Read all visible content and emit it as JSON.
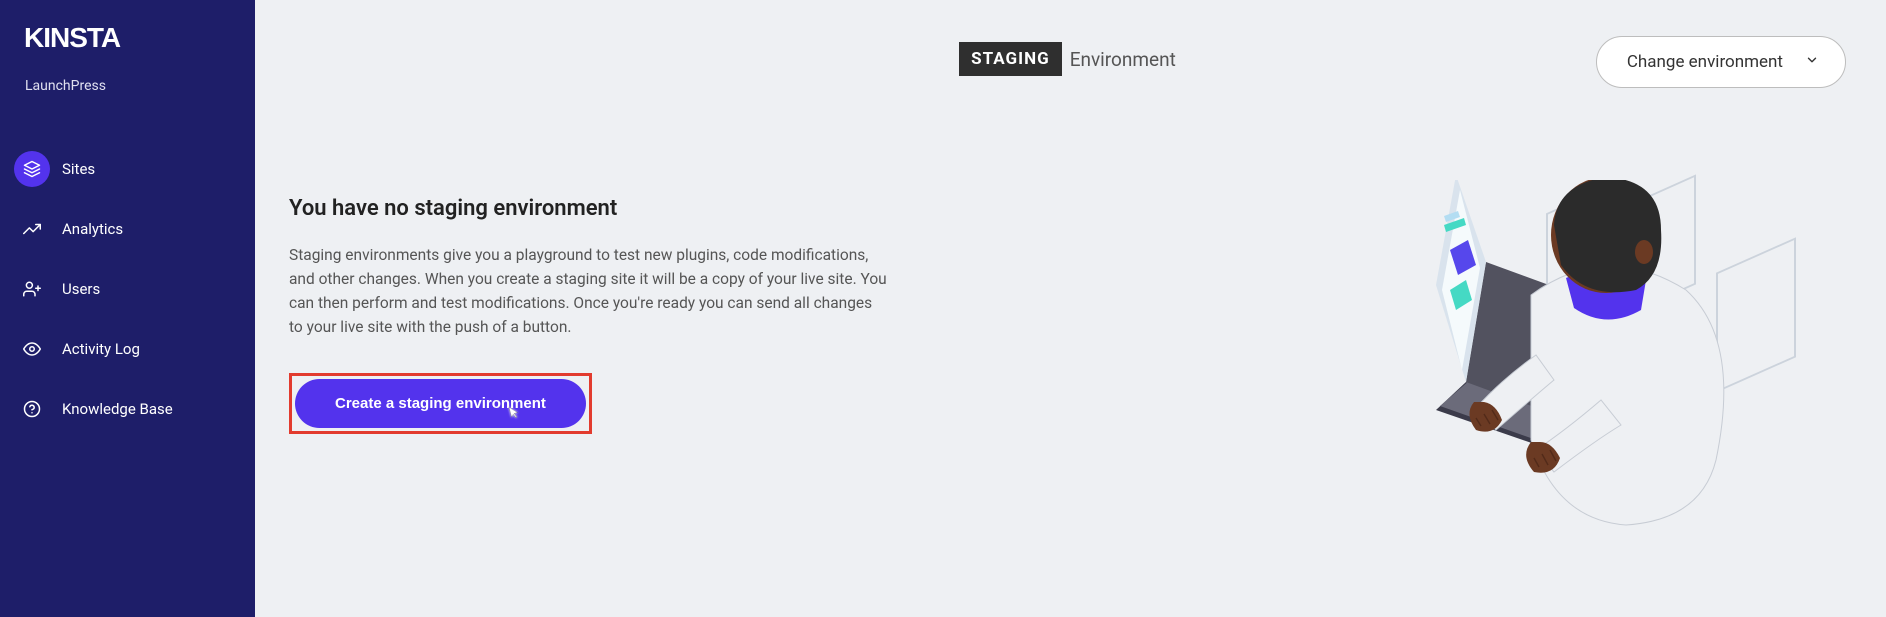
{
  "brand": "KINSTA",
  "site_name": "LaunchPress",
  "sidebar": {
    "items": [
      {
        "label": "Sites",
        "icon": "layers",
        "active": true
      },
      {
        "label": "Analytics",
        "icon": "trending-up",
        "active": false
      },
      {
        "label": "Users",
        "icon": "user-plus",
        "active": false
      },
      {
        "label": "Activity Log",
        "icon": "eye",
        "active": false
      },
      {
        "label": "Knowledge Base",
        "icon": "help-circle",
        "active": false
      }
    ]
  },
  "header": {
    "badge": "STAGING",
    "label": "Environment",
    "dropdown_label": "Change environment"
  },
  "content": {
    "heading": "You have no staging environment",
    "body": "Staging environments give you a playground to test new plugins, code modifications, and other changes. When you create a staging site it will be a copy of your live site. You can then perform and test modifications. Once you're ready you can send all changes to your live site with the push of a button.",
    "cta_label": "Create a staging environment"
  }
}
